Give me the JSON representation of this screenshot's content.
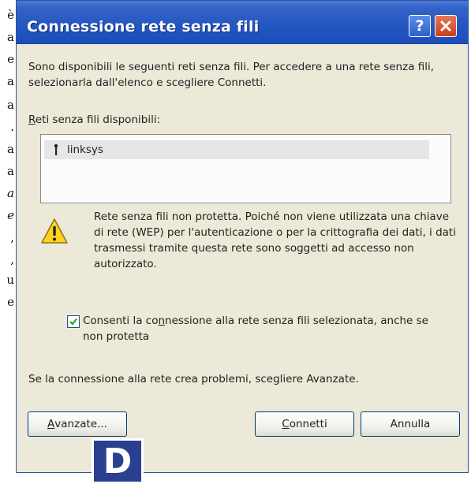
{
  "page_fragment": [
    "è",
    "a",
    "e",
    "a",
    "a",
    ".",
    "a",
    "a",
    "a",
    "e",
    ",",
    ",",
    "u",
    "e"
  ],
  "dialog": {
    "title": "Connessione rete senza fili",
    "intro": "Sono disponibili le seguenti reti senza fili. Per accedere a una rete senza fili, selezionarla dall'elenco e scegliere Connetti.",
    "available_label_accel": "R",
    "available_label_rest": "eti senza fili disponibili:",
    "networks": [
      {
        "name": "linksys"
      }
    ],
    "warning": "Rete senza fili non protetta. Poiché non viene utilizzata una chiave di rete (WEP) per l'autenticazione o per la crittografia dei dati, i dati trasmessi tramite questa rete sono soggetti ad accesso non autorizzato.",
    "allow_checkbox": {
      "checked": true,
      "label_pre": "Consenti la co",
      "label_accel": "n",
      "label_post": "nessione alla rete senza fili selezionata, anche se non protetta"
    },
    "advanced_hint": "Se la connessione alla rete crea problemi, scegliere Avanzate.",
    "buttons": {
      "advanced_accel": "A",
      "advanced_rest": "vanzate...",
      "connect_accel": "C",
      "connect_rest": "onnetti",
      "cancel": "Annulla"
    },
    "icons": {
      "help": "help-icon",
      "close": "close-icon",
      "warning": "warning-icon",
      "antenna": "antenna-icon",
      "check": "check-icon"
    }
  },
  "badge": "D",
  "colors": {
    "titlebar": "#2456c0",
    "dialog_bg": "#ece9d8",
    "close": "#c8401c",
    "badge": "#2a3f8f"
  }
}
